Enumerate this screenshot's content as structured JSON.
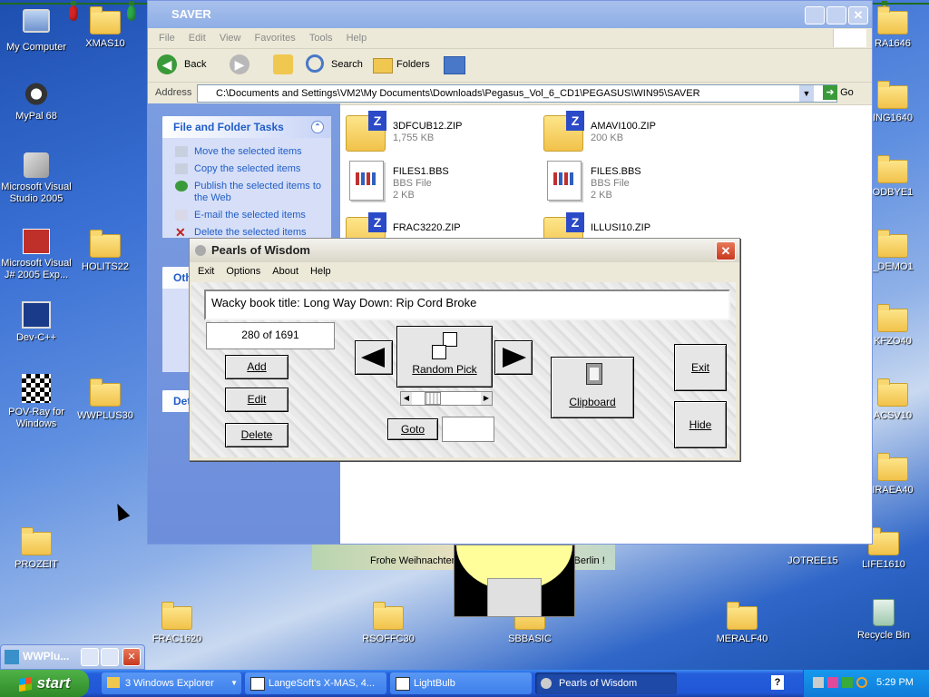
{
  "colors": {
    "xp_blue": "#245edb",
    "start_green": "#3c9a34",
    "link_blue": "#215dc6",
    "close_red": "#d8452a"
  },
  "desktop_icons": [
    {
      "label": "My Computer"
    },
    {
      "label": "XMAS10"
    },
    {
      "label": "MyPal 68"
    },
    {
      "label": "Microsoft Visual Studio 2005"
    },
    {
      "label": "Microsoft Visual J# 2005 Exp..."
    },
    {
      "label": "HOLITS22"
    },
    {
      "label": "Dev-C++"
    },
    {
      "label": "POV-Ray for Windows"
    },
    {
      "label": "WWPLUS30"
    },
    {
      "label": "PROZEIT"
    },
    {
      "label": "FRAC1620"
    },
    {
      "label": "RSOFFC30"
    },
    {
      "label": "SBBASIC"
    },
    {
      "label": "MERALF40"
    },
    {
      "label": "RA1646"
    },
    {
      "label": "ING1640"
    },
    {
      "label": "ODBYE1"
    },
    {
      "label": "_DEMO1"
    },
    {
      "label": "KFZO40"
    },
    {
      "label": "ACSV10"
    },
    {
      "label": "IRAEA40"
    },
    {
      "label": "LIFE1610"
    },
    {
      "label": "JOTREE15"
    },
    {
      "label": "Recycle Bin"
    }
  ],
  "explorer": {
    "title": "SAVER",
    "menu": [
      "File",
      "Edit",
      "View",
      "Favorites",
      "Tools",
      "Help"
    ],
    "toolbar": {
      "back": "Back",
      "search": "Search",
      "folders": "Folders"
    },
    "address_label": "Address",
    "address": "C:\\Documents and Settings\\VM2\\My Documents\\Downloads\\Pegasus_Vol_6_CD1\\PEGASUS\\WIN95\\SAVER",
    "go": "Go",
    "tasks_title": "File and Folder Tasks",
    "tasks": [
      "Move the selected items",
      "Copy the selected items",
      "Publish the selected items to the Web",
      "E-mail the selected items",
      "Delete the selected items"
    ],
    "other_title": "Oth",
    "details_title": "Det",
    "files": [
      {
        "name": "3DFCUB12.ZIP",
        "sub": "1,755 KB",
        "icon": "zip-folder-icon"
      },
      {
        "name": "AMAVI100.ZIP",
        "sub": "200 KB",
        "icon": "zip-folder-icon"
      },
      {
        "name": "FILES1.BBS",
        "sub": "BBS File",
        "size": "2 KB",
        "icon": "bbs-file-icon"
      },
      {
        "name": "FILES.BBS",
        "sub": "BBS File",
        "size": "2 KB",
        "icon": "bbs-file-icon"
      },
      {
        "name": "FRAC3220.ZIP",
        "sub": "",
        "icon": "zip-folder-icon"
      },
      {
        "name": "ILLUSI10.ZIP",
        "sub": "",
        "icon": "zip-folder-icon"
      }
    ]
  },
  "pearls": {
    "title": "Pearls of Wisdom",
    "menu": [
      "Exit",
      "Options",
      "About",
      "Help"
    ],
    "quote": "Wacky book title: Long Way Down: Rip Cord Broke",
    "counter": "280 of 1691",
    "scroll_position_fraction": 0.24,
    "buttons": {
      "add": "Add",
      "edit": "Edit",
      "delete": "Delete",
      "random": "Random Pick",
      "goto": "Goto",
      "clipboard": "Clipboard",
      "exit": "Exit",
      "hide": "Hide"
    },
    "goto_value": ""
  },
  "xmas_strip": {
    "left": "Frohe Weihnachten",
    "right": "s Berlin !"
  },
  "wwplus_mini": {
    "title": "WWPlu..."
  },
  "taskbar": {
    "start": "start",
    "buttons": [
      "3 Windows Explorer",
      "LangeSoft's X-MAS, 4...",
      "LightBulb",
      "Pearls of Wisdom"
    ],
    "clock": "5:29 PM"
  }
}
